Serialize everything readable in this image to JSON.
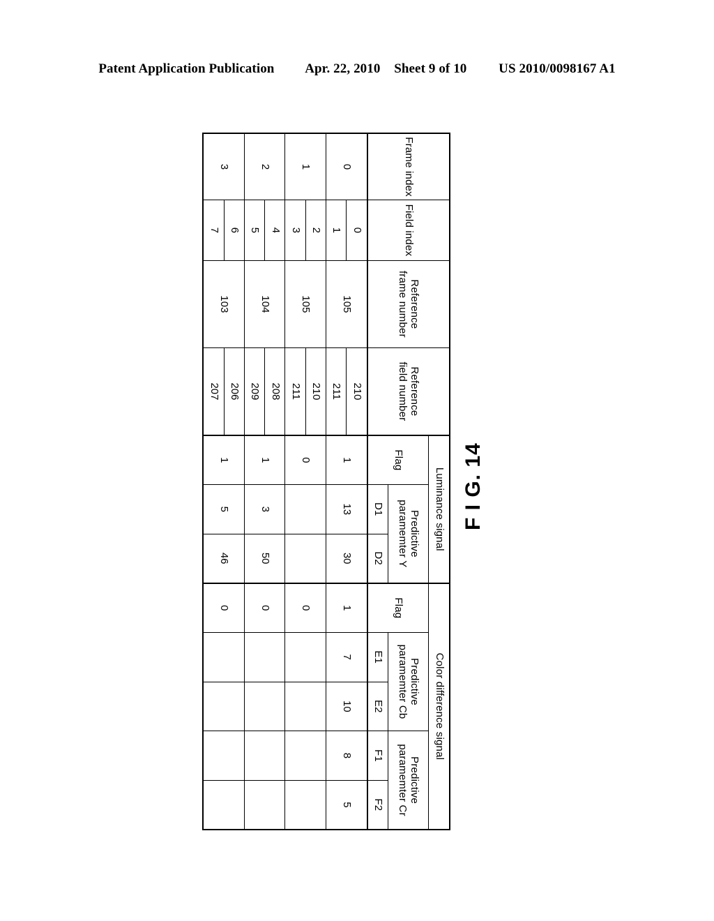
{
  "header": {
    "publication": "Patent Application Publication",
    "date": "Apr. 22, 2010",
    "sheet": "Sheet 9 of 10",
    "patent_number": "US 2010/0098167 A1"
  },
  "figure": {
    "label": "F I G. 14"
  },
  "table": {
    "columns": {
      "frame_index": "Frame index",
      "field_index": "Field index",
      "reference_frame_number_l1": "Reference",
      "reference_frame_number_l2": "frame number",
      "reference_field_number_l1": "Reference",
      "reference_field_number_l2": "field number",
      "luminance_signal": "Luminance signal",
      "color_difference_signal": "Color difference signal",
      "flag": "Flag",
      "predictive_l1": "Predictive",
      "predictive_param_y_l2": "paramemter Y",
      "predictive_param_cb_l2": "paramemter Cb",
      "predictive_param_cr_l2": "paramemter Cr",
      "d1": "D1",
      "d2": "D2",
      "e1": "E1",
      "e2": "E2",
      "f1": "F1",
      "f2": "F2"
    },
    "rows": [
      {
        "frame_index": "0",
        "field_index": [
          "0",
          "1"
        ],
        "reference_frame_number": "105",
        "reference_field_number": [
          "210",
          "211"
        ],
        "luminance_flag": "1",
        "d1": "13",
        "d2": "30",
        "color_flag": "1",
        "e1": "7",
        "e2": "10",
        "f1": "8",
        "f2": "5"
      },
      {
        "frame_index": "1",
        "field_index": [
          "2",
          "3"
        ],
        "reference_frame_number": "105",
        "reference_field_number": [
          "210",
          "211"
        ],
        "luminance_flag": "0",
        "d1": "",
        "d2": "",
        "color_flag": "0",
        "e1": "",
        "e2": "",
        "f1": "",
        "f2": ""
      },
      {
        "frame_index": "2",
        "field_index": [
          "4",
          "5"
        ],
        "reference_frame_number": "104",
        "reference_field_number": [
          "208",
          "209"
        ],
        "luminance_flag": "1",
        "d1": "3",
        "d2": "50",
        "color_flag": "0",
        "e1": "",
        "e2": "",
        "f1": "",
        "f2": ""
      },
      {
        "frame_index": "3",
        "field_index": [
          "6",
          "7"
        ],
        "reference_frame_number": "103",
        "reference_field_number": [
          "206",
          "207"
        ],
        "luminance_flag": "1",
        "d1": "5",
        "d2": "46",
        "color_flag": "0",
        "e1": "",
        "e2": "",
        "f1": "",
        "f2": ""
      }
    ]
  }
}
